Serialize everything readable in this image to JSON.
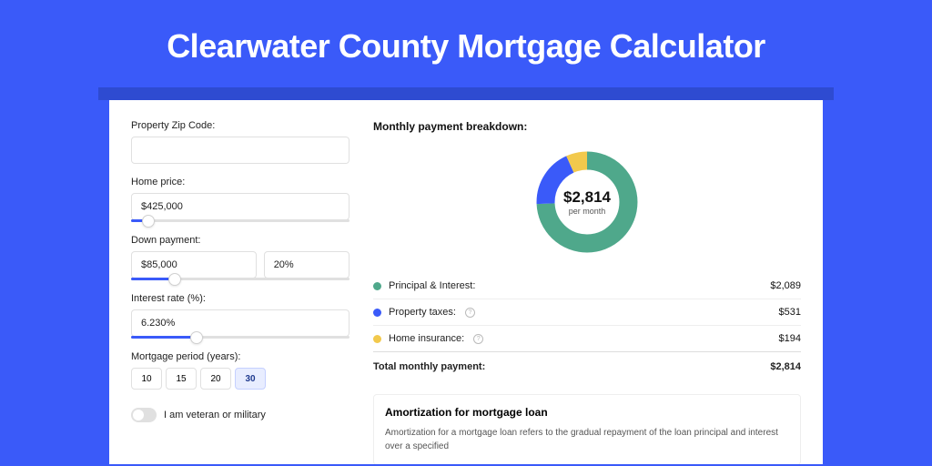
{
  "header": {
    "title": "Clearwater County Mortgage Calculator"
  },
  "form": {
    "zip_label": "Property Zip Code:",
    "zip_value": "",
    "home_price_label": "Home price:",
    "home_price_value": "$425,000",
    "home_price_slider_pct": 8,
    "down_payment_label": "Down payment:",
    "down_payment_value": "$85,000",
    "down_payment_pct_value": "20%",
    "down_payment_slider_pct": 20,
    "rate_label": "Interest rate (%):",
    "rate_value": "6.230%",
    "rate_slider_pct": 30,
    "period_label": "Mortgage period (years):",
    "periods": [
      "10",
      "15",
      "20",
      "30"
    ],
    "period_selected": "30",
    "veteran_label": "I am veteran or military"
  },
  "breakdown": {
    "title": "Monthly payment breakdown:",
    "total": "$2,814",
    "per_month": "per month",
    "items": [
      {
        "label": "Principal & Interest:",
        "value": "$2,089",
        "color": "#4fa88b",
        "info": false
      },
      {
        "label": "Property taxes:",
        "value": "$531",
        "color": "#3a5af9",
        "info": true
      },
      {
        "label": "Home insurance:",
        "value": "$194",
        "color": "#f2c94c",
        "info": true
      }
    ],
    "total_label": "Total monthly payment:",
    "total_value": "$2,814"
  },
  "amort": {
    "title": "Amortization for mortgage loan",
    "text": "Amortization for a mortgage loan refers to the gradual repayment of the loan principal and interest over a specified"
  },
  "chart_data": {
    "type": "pie",
    "title": "Monthly payment breakdown",
    "series": [
      {
        "name": "Principal & Interest",
        "value": 2089,
        "color": "#4fa88b"
      },
      {
        "name": "Property taxes",
        "value": 531,
        "color": "#3a5af9"
      },
      {
        "name": "Home insurance",
        "value": 194,
        "color": "#f2c94c"
      }
    ],
    "total": 2814,
    "center_label": "$2,814 per month"
  }
}
